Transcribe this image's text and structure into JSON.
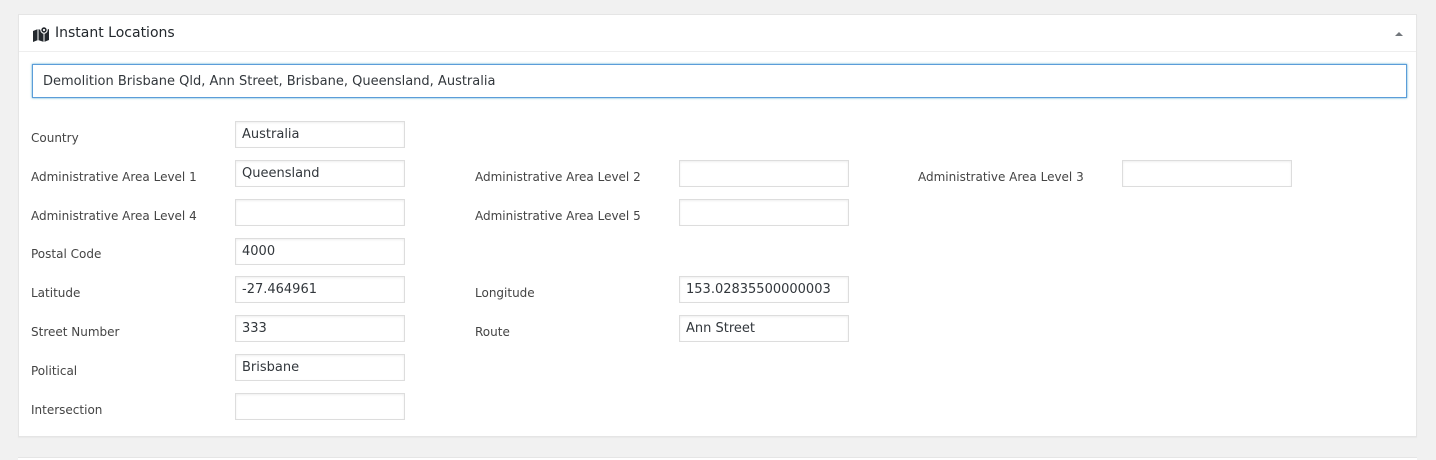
{
  "metabox": {
    "title": "Instant Locations",
    "icon": "map-marker-icon",
    "toggle_icon": "collapse-arrow-icon"
  },
  "search": {
    "value": "Demolition Brisbane Qld, Ann Street, Brisbane, Queensland, Australia"
  },
  "fields": {
    "country": {
      "label": "Country",
      "value": "Australia"
    },
    "admin_area_1": {
      "label": "Administrative Area Level 1",
      "value": "Queensland"
    },
    "admin_area_2": {
      "label": "Administrative Area Level 2",
      "value": ""
    },
    "admin_area_3": {
      "label": "Administrative Area Level 3",
      "value": ""
    },
    "admin_area_4": {
      "label": "Administrative Area Level 4",
      "value": ""
    },
    "admin_area_5": {
      "label": "Administrative Area Level 5",
      "value": ""
    },
    "postal_code": {
      "label": "Postal Code",
      "value": "4000"
    },
    "latitude": {
      "label": "Latitude",
      "value": "-27.464961"
    },
    "longitude": {
      "label": "Longitude",
      "value": "153.02835500000003"
    },
    "street_number": {
      "label": "Street Number",
      "value": "333"
    },
    "route": {
      "label": "Route",
      "value": "Ann Street"
    },
    "political": {
      "label": "Political",
      "value": "Brisbane"
    },
    "intersection": {
      "label": "Intersection",
      "value": ""
    }
  },
  "colors": {
    "focus_border": "#5b9dd9",
    "background": "#f1f1f1",
    "panel": "#ffffff"
  }
}
